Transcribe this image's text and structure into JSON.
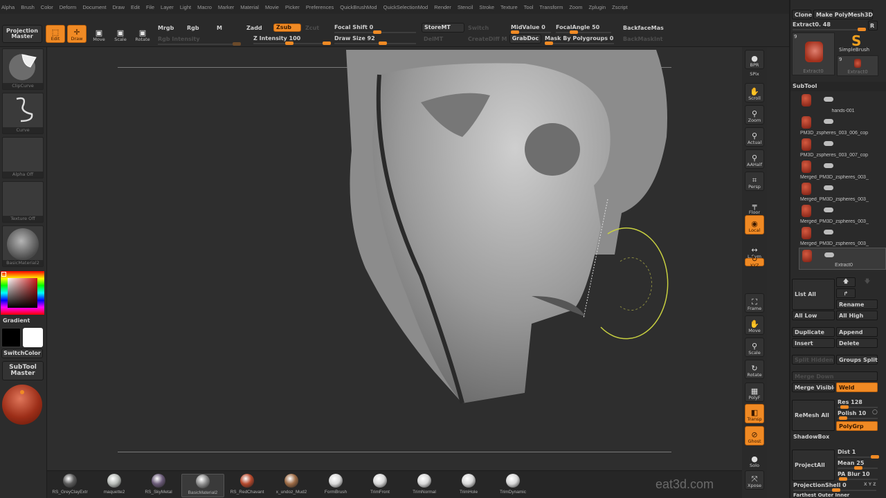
{
  "menu": [
    "Alpha",
    "Brush",
    "Color",
    "Deform",
    "Document",
    "Draw",
    "Edit",
    "File",
    "Layer",
    "Light",
    "Macro",
    "Marker",
    "Material",
    "Movie",
    "Picker",
    "Preferences",
    "QuickBrushMod",
    "QuickSelectionMod",
    "Render",
    "Stencil",
    "Stroke",
    "Texture",
    "Tool",
    "Transform",
    "Zoom",
    "Zplugin",
    "Zscript"
  ],
  "topbar": {
    "projection_master": "Projection\nMaster",
    "edit": "Edit",
    "draw": "Draw",
    "move": "Move",
    "scale": "Scale",
    "rotate": "Rotate",
    "mrgb": "Mrgb",
    "rgb": "Rgb",
    "m": "M",
    "rgb_intensity": "Rgb Intensity",
    "zadd": "Zadd",
    "zsub": "Zsub",
    "zcut": "Zcut",
    "z_intensity": "Z Intensity 100",
    "focal_shift": "Focal Shift 0",
    "draw_size": "Draw Size 92",
    "storemt": "StoreMT",
    "switch": "Switch",
    "delmt": "DelMT",
    "creatediff": "CreateDiff M",
    "midvalue": "MidValue 0",
    "grabdoc": "GrabDoc",
    "focal_angle": "FocalAngle 50",
    "mask_by_polygroups": "Mask By Polygroups 0",
    "backface_mask": "BackfaceMas",
    "backmask_int": "BackMaskInt",
    "slider_values": {
      "z_intensity": 100,
      "focal_shift": 0,
      "draw_size": 92,
      "midvalue": 0,
      "focal_angle": 50,
      "mask_by_polygroups": 0
    }
  },
  "leftbar": {
    "brush": "ClipCurve",
    "stroke": "Curve",
    "alpha": "Alpha Off",
    "texture": "Texture Off",
    "material": "BasicMaterial2",
    "gradient": "Gradient",
    "switch_color": "SwitchColor",
    "subtool_master": "SubTool\nMaster",
    "main_color": "#c0402a",
    "secondary_color": "#000000",
    "tertiary_color": "#ffffff"
  },
  "materials": [
    {
      "name": "RS_GreyClayExtr",
      "color": "#5a5a5a"
    },
    {
      "name": "maquette2",
      "color": "#b8bcb8"
    },
    {
      "name": "RS_SkyMetal",
      "color": "#6a5a78"
    },
    {
      "name": "BasicMaterial2",
      "color": "#8a8a8a",
      "selected": true
    },
    {
      "name": "RS_RedChavant",
      "color": "#b5482c"
    },
    {
      "name": "x_undoz_Mud2",
      "color": "#9c6a44"
    },
    {
      "name": "FormBrush",
      "color": "#d8d8d8"
    },
    {
      "name": "TrimFront",
      "color": "#d8d8d8"
    },
    {
      "name": "TrimNormal",
      "color": "#d8d8d8"
    },
    {
      "name": "TrimHole",
      "color": "#d8d8d8"
    },
    {
      "name": "TrimDynamic",
      "color": "#d8d8d8"
    }
  ],
  "watermark": "eat3d.com",
  "dock": [
    {
      "label": "BPR",
      "glyph": "●",
      "name": "bpr"
    },
    {
      "label": "SPix",
      "glyph": "",
      "name": "spix"
    },
    {
      "label": "Scroll",
      "glyph": "✋",
      "name": "scroll"
    },
    {
      "label": "Zoom",
      "glyph": "⚲",
      "name": "zoom"
    },
    {
      "label": "Actual",
      "glyph": "⚲",
      "name": "actual"
    },
    {
      "label": "AAHalf",
      "glyph": "⚲",
      "name": "aahalf"
    },
    {
      "label": "Persp",
      "glyph": "⌗",
      "name": "persp"
    },
    {
      "label": "Floor",
      "glyph": "╤",
      "name": "floor"
    },
    {
      "label": "Local",
      "glyph": "◉",
      "name": "local"
    },
    {
      "label": "L.Sym",
      "glyph": "↔",
      "name": "lsym"
    },
    {
      "label": "XYZ",
      "glyph": "↻",
      "name": "xyz"
    },
    {
      "label": "Frame",
      "glyph": "⛶",
      "name": "frame"
    },
    {
      "label": "Move",
      "glyph": "✋",
      "name": "move"
    },
    {
      "label": "Scale",
      "glyph": "⚲",
      "name": "scale"
    },
    {
      "label": "Rotate",
      "glyph": "↻",
      "name": "rotate"
    },
    {
      "label": "PolyF",
      "glyph": "▦",
      "name": "polyf"
    },
    {
      "label": "Transp",
      "glyph": "◧",
      "name": "transp"
    },
    {
      "label": "Ghost",
      "glyph": "⊘",
      "name": "ghost"
    },
    {
      "label": "Solo",
      "glyph": "●",
      "name": "solo"
    },
    {
      "label": "Xpose",
      "glyph": "⤧",
      "name": "xpose"
    }
  ],
  "rightpanel": {
    "clone": "Clone",
    "make_polymesh": "Make PolyMesh3D",
    "tool_slider": "Extract0. 48",
    "r": "R",
    "tool_count_a": "9",
    "tool_count_b": "9",
    "tool_name_a": "Extract0",
    "simple_brush": "SimpleBrush",
    "tool_name_b": "Extract0",
    "subtool_header": "SubTool",
    "subtools": [
      "hands-001",
      "PM3D_zspheres_003_006_cop",
      "PM3D_zspheres_003_007_cop",
      "Merged_PM3D_zspheres_003_",
      "Merged_PM3D_zspheres_003_",
      "Merged_PM3D_zspheres_003_",
      "Merged_PM3D_zspheres_003_",
      "Extract0"
    ],
    "list_all": "List All",
    "rename": "Rename",
    "all_low": "All Low",
    "all_high": "All High",
    "duplicate": "Duplicate",
    "append": "Append",
    "insert": "Insert",
    "delete": "Delete",
    "split_hidden": "Split Hidden",
    "groups_split": "Groups Split",
    "merge_down": "Merge Down",
    "merge_visible": "Merge Visible",
    "weld": "Weld",
    "remesh_all": "ReMesh All",
    "res": "Res 128",
    "polish": "Polish 10",
    "polygrp": "PolyGrp",
    "shadowbox": "ShadowBox",
    "project_all": "ProjectAll",
    "dist": "Dist 1",
    "mean": "Mean 25",
    "pa_blur": "PA Blur 10",
    "projection_shell": "ProjectionShell 0",
    "xyz": "X Y Z",
    "farthest": "Farthest Outer Inner"
  }
}
